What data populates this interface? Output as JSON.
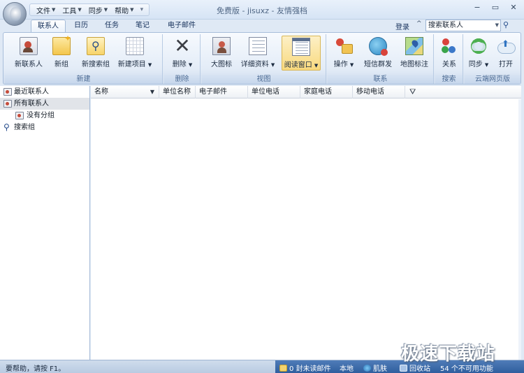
{
  "window": {
    "title": "免费版 - jisuxz - 友情强档",
    "minimize_glyph": "−",
    "maximize_glyph": "▭",
    "close_glyph": "✕"
  },
  "menu": {
    "items": [
      "文件",
      "工具",
      "同步",
      "帮助"
    ],
    "separator": "▾"
  },
  "tabs": [
    "联系人",
    "日历",
    "任务",
    "笔记",
    "电子邮件"
  ],
  "active_tab": "联系人",
  "account": {
    "login_label": "登录",
    "collapse_glyph": "^",
    "search_value": "搜索联系人"
  },
  "ribbon": {
    "groups": [
      {
        "label": "新建",
        "buttons": [
          {
            "label": "新联系人",
            "icon": "contact-card-icon"
          },
          {
            "label": "新组",
            "icon": "new-group-icon"
          },
          {
            "label": "新搜索组",
            "icon": "search-group-icon"
          },
          {
            "label": "新建项目",
            "icon": "calendar-icon",
            "dropdown": true
          }
        ]
      },
      {
        "label": "删除",
        "buttons": [
          {
            "label": "删除",
            "icon": "delete-icon",
            "dropdown": true
          }
        ]
      },
      {
        "label": "视图",
        "buttons": [
          {
            "label": "大图标",
            "icon": "large-icon-view-icon"
          },
          {
            "label": "详细资料",
            "icon": "detail-view-icon",
            "dropdown": true
          },
          {
            "label": "阅读窗口",
            "icon": "reading-pane-icon",
            "dropdown": true,
            "selected": true
          }
        ]
      },
      {
        "label": "联系",
        "buttons": [
          {
            "label": "操作",
            "icon": "operations-icon",
            "dropdown": true
          },
          {
            "label": "短信群发",
            "icon": "sms-icon"
          },
          {
            "label": "地图标注",
            "icon": "map-icon"
          }
        ]
      },
      {
        "label": "搜索",
        "buttons": [
          {
            "label": "关系",
            "icon": "relationship-icon"
          }
        ]
      },
      {
        "label": "云端网页版",
        "buttons": [
          {
            "label": "同步",
            "icon": "sync-icon",
            "dropdown": true
          },
          {
            "label": "打开",
            "icon": "open-web-icon"
          }
        ]
      }
    ]
  },
  "nav": {
    "items": [
      {
        "label": "最近联系人",
        "icon": "contact-card-icon"
      },
      {
        "label": "所有联系人",
        "icon": "contact-card-icon",
        "selected": true
      },
      {
        "label": "没有分组",
        "icon": "contact-card-icon",
        "indent": true
      },
      {
        "label": "搜索组",
        "icon": "search-icon"
      }
    ]
  },
  "table": {
    "columns": [
      "名称",
      "单位名称",
      "电子邮件",
      "单位电话",
      "家庭电话",
      "移动电话"
    ],
    "sort_glyph": "▼",
    "filter_glyph": "⛛",
    "rows": []
  },
  "status": {
    "help_text": "要帮助，请按 F1。",
    "unread_mail": "0 封未读邮件",
    "location": "本地",
    "skin": "肌肤",
    "recycle_bin": "回收站",
    "unavailable": "54 个不可用功能"
  },
  "watermark": "极速下载站",
  "colors": {
    "accent": "#2f5e9e",
    "ribbon_highlight": "#f8d97e",
    "background": "#dfe9f5"
  }
}
